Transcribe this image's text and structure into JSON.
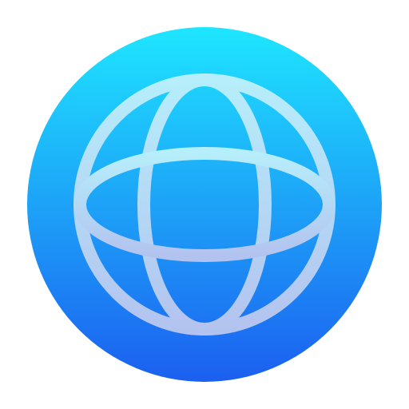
{
  "app_icon": {
    "icon": "globe-icon",
    "colors": {
      "background_top": "#1ee6ff",
      "background_bottom": "#1c5ff0",
      "glyph_top": "#b6eefb",
      "glyph_bottom": "#b3c3ef",
      "page_background": "#ffffff"
    }
  }
}
